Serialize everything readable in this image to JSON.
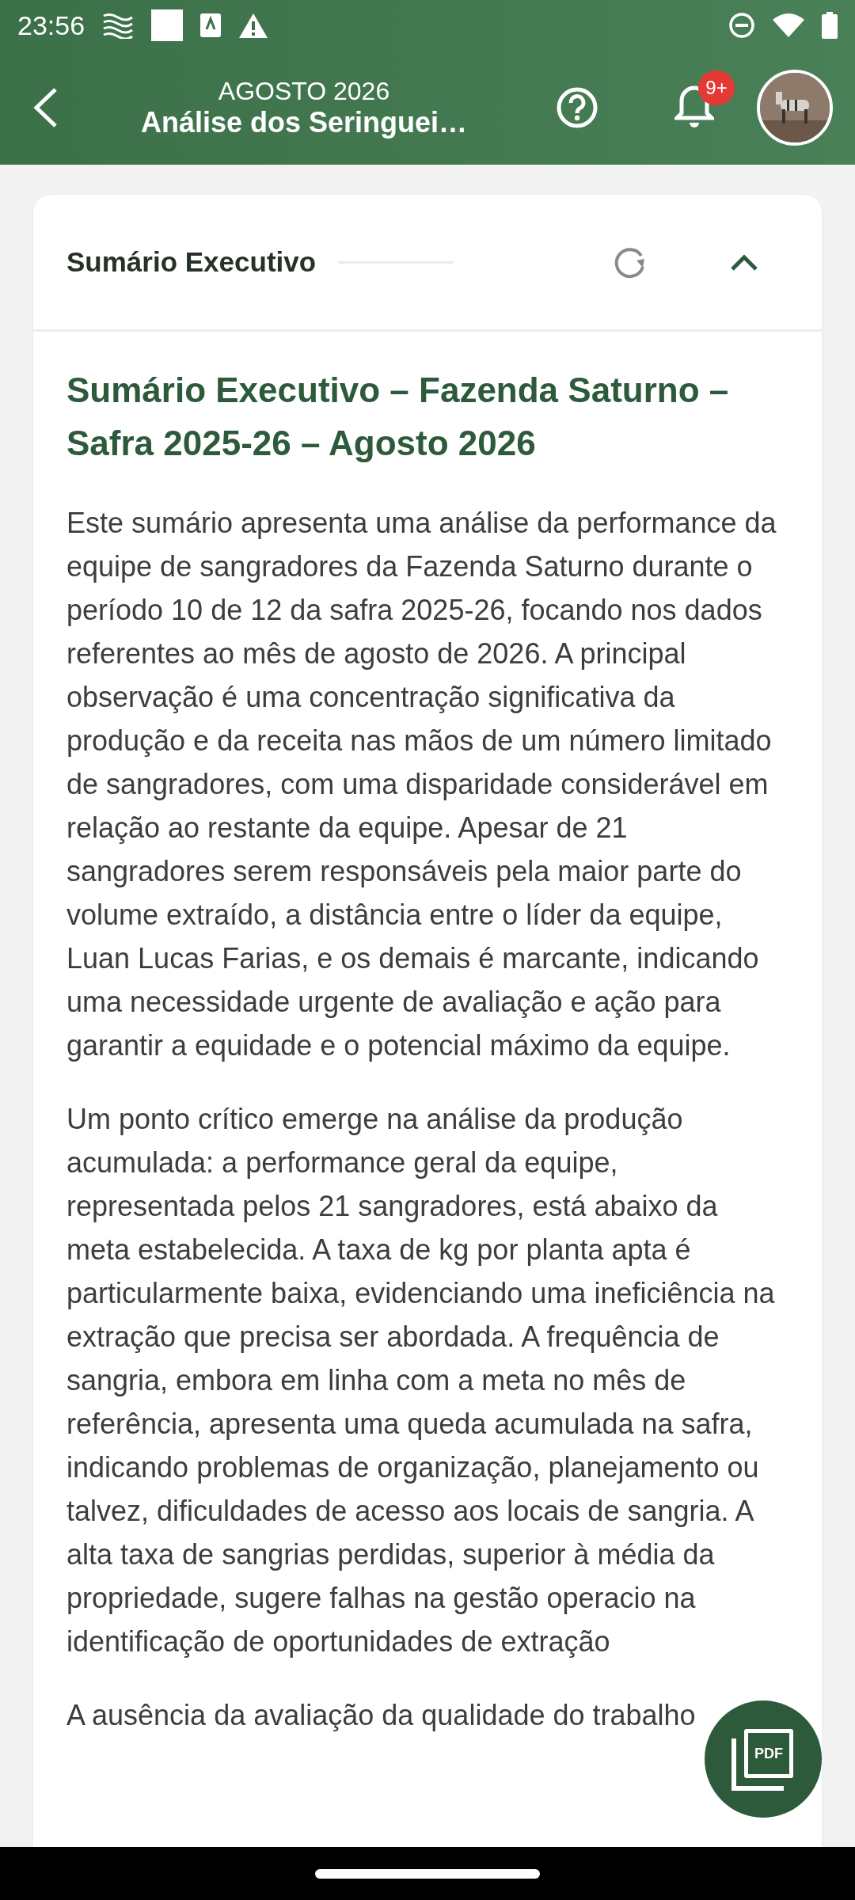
{
  "status_bar": {
    "time": "23:56"
  },
  "app_bar": {
    "subtitle": "AGOSTO 2026",
    "title": "Análise dos Seringuei…",
    "notification_badge": "9+"
  },
  "section": {
    "title": "Sumário Executivo",
    "expanded": true,
    "heading": "Sumário Executivo – Fazenda Saturno – Safra 2025-26 – Agosto 2026",
    "paragraphs": [
      "Este sumário apresenta uma análise da performance da equipe de sangradores da Fazenda Saturno durante o período 10 de 12 da safra 2025-26, focando nos dados referentes ao mês de agosto de 2026. A principal observação é uma concentração significativa da produção e da receita nas mãos de um número limitado de sangradores, com uma disparidade considerável em relação ao restante da equipe. Apesar de 21 sangradores serem responsáveis pela maior parte do volume extraído, a distância entre o líder da equipe, Luan Lucas Farias, e os demais é marcante, indicando uma necessidade urgente de avaliação e ação para garantir a equidade e o potencial máximo da equipe.",
      "Um ponto crítico emerge na análise da produção acumulada: a performance geral da equipe, representada pelos 21 sangradores, está abaixo da meta estabelecida. A taxa de kg por planta apta é particularmente baixa, evidenciando uma ineficiência na extração que precisa ser abordada. A frequência de sangria, embora em linha com a meta no mês de referência, apresenta uma queda acumulada na safra, indicando problemas de organização, planejamento ou talvez, dificuldades de acesso aos locais de sangria. A alta taxa de sangrias perdidas, superior à média da propriedade, sugere falhas na gestão operacio na identificação de oportunidades de extração",
      "A ausência da avaliação da qualidade do trabalho"
    ]
  },
  "fab": {
    "label": "PDF"
  }
}
